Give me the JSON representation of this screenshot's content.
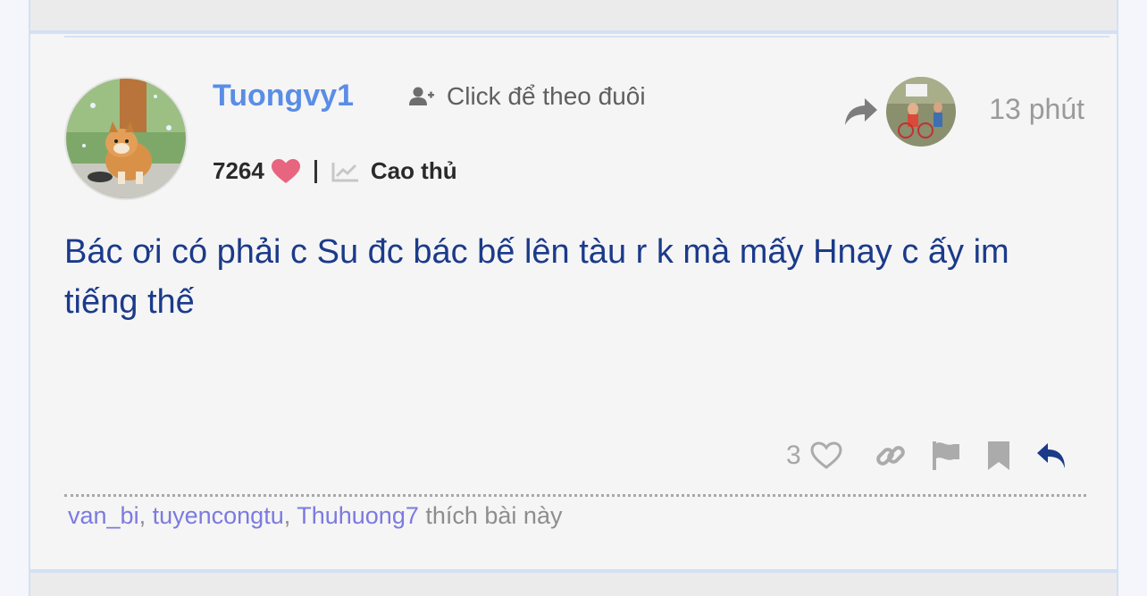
{
  "post": {
    "username": "Tuongvy1",
    "follow_label": "Click để theo đuôi",
    "points": "7264",
    "rank": "Cao thủ",
    "time": "13 phút",
    "content": "Bác ơi có phải c Su đc bác bế lên tàu r k mà mấy Hnay c ấy im tiếng thế",
    "like_count": "3",
    "likers": [
      "van_bi",
      "tuyencongtu",
      "Thuhuong7"
    ],
    "likers_sep": ", ",
    "likes_suffix": " thích bài này"
  },
  "icons": {
    "follow": "user-plus-icon",
    "points": "heart-icon",
    "rank": "chart-line-icon",
    "share": "share-arrow-icon",
    "like": "heart-outline-icon",
    "link": "link-icon",
    "flag": "flag-icon",
    "bookmark": "bookmark-icon",
    "reply": "reply-icon"
  },
  "colors": {
    "username": "#5a8de6",
    "content": "#1b3a8a",
    "heart": "#e8657f",
    "liker": "#7c7ae0",
    "reply": "#1b3a8a",
    "muted": "#a6a6a6"
  }
}
